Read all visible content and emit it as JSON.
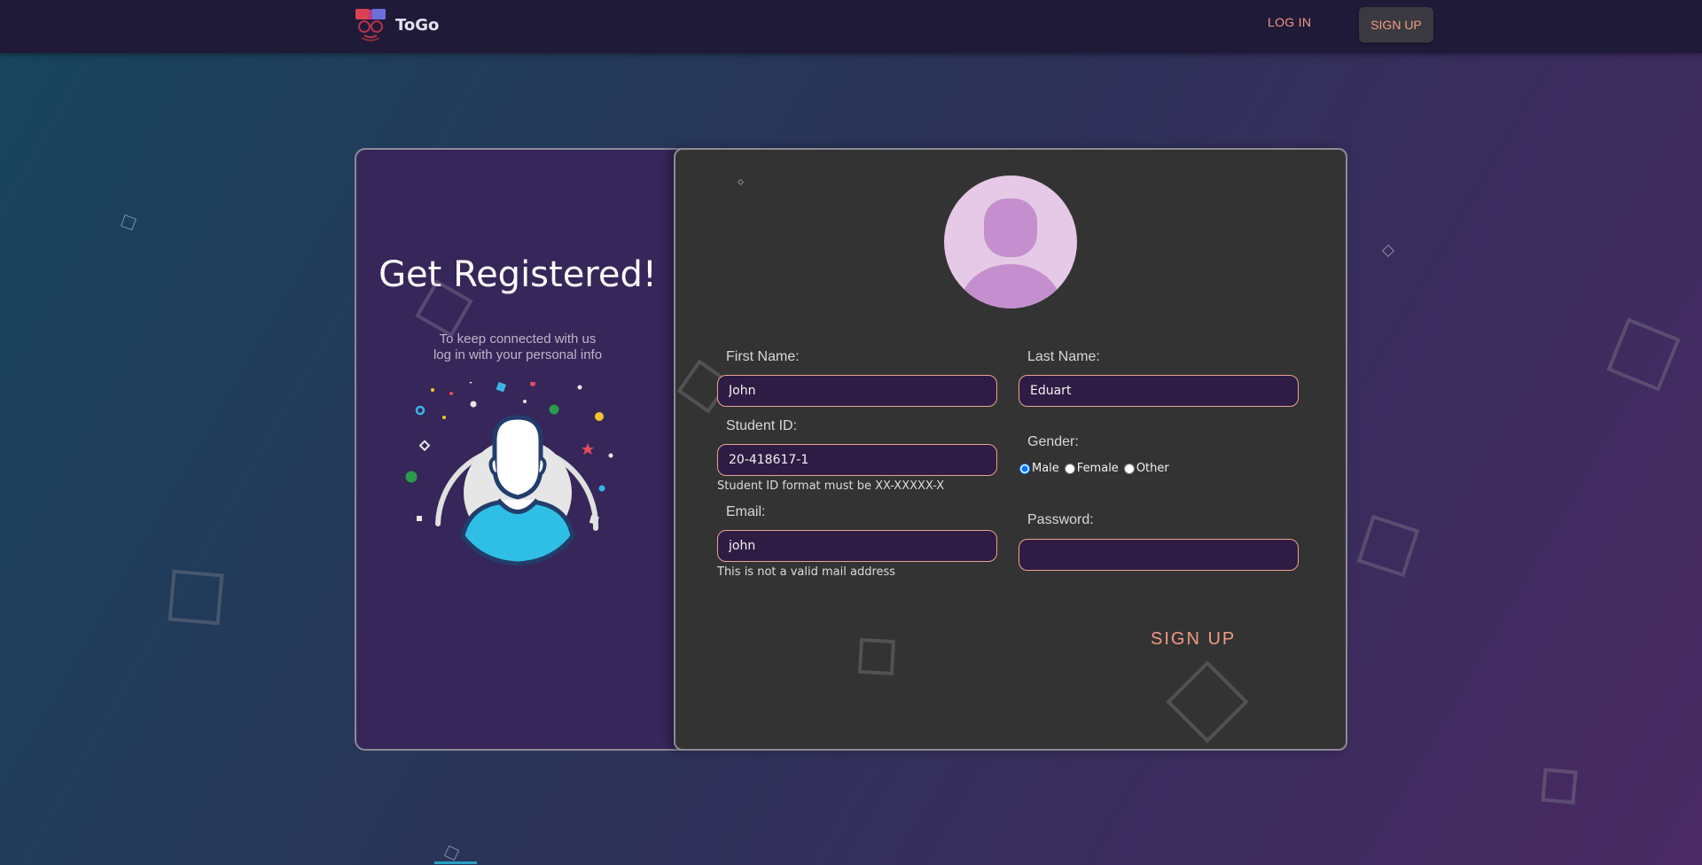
{
  "nav": {
    "brand_name": "ToGo",
    "login_label": "LOG IN",
    "signup_label": "SIGN UP"
  },
  "left": {
    "title": "Get Registered!",
    "subtitle_line1": "To keep connected with us",
    "subtitle_line2": "log in with your personal info"
  },
  "form": {
    "first_name": {
      "label": "First Name:",
      "value": "John"
    },
    "last_name": {
      "label": "Last Name:",
      "value": "Eduart"
    },
    "student_id": {
      "label": "Student ID:",
      "value": "20-418617-1",
      "hint": "Student ID format must be XX-XXXXX-X"
    },
    "gender": {
      "label": "Gender:",
      "options": [
        "Male",
        "Female",
        "Other"
      ],
      "selected": "Male"
    },
    "email": {
      "label": "Email:",
      "value": "john",
      "hint": "This is not a valid mail address"
    },
    "password": {
      "label": "Password:",
      "value": ""
    },
    "submit_label": "SIGN UP"
  },
  "colors": {
    "accent": "#f29a82",
    "left_panel": "#362659",
    "right_panel": "#333333",
    "field_bg": "#2f1c44",
    "field_border": "#e8a48e",
    "navbar": "#1f1a38"
  },
  "icons": {
    "logo": "togo-logo-icon",
    "avatar": "user-avatar-icon",
    "illustration": "registered-user-icon"
  }
}
